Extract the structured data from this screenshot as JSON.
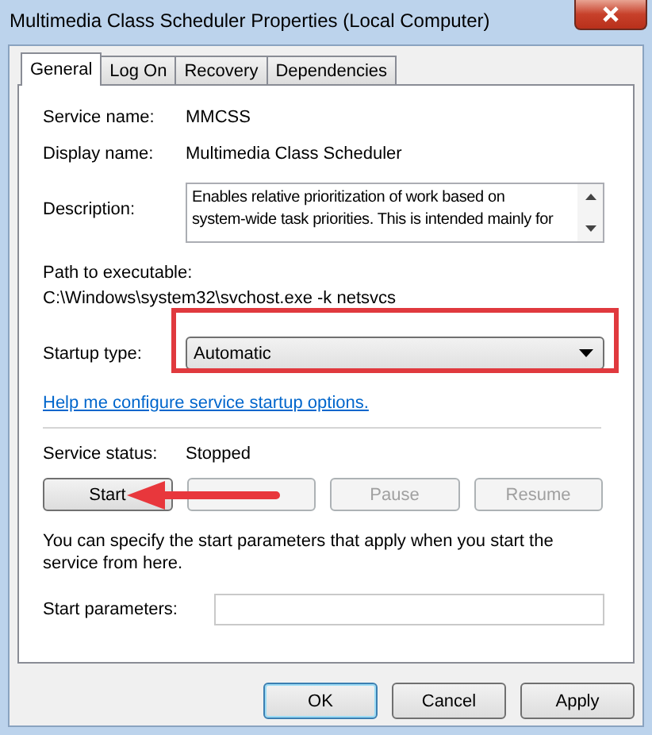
{
  "window": {
    "title": "Multimedia Class Scheduler Properties (Local Computer)"
  },
  "tabs": [
    {
      "label": "General",
      "selected": true
    },
    {
      "label": "Log On",
      "selected": false
    },
    {
      "label": "Recovery",
      "selected": false
    },
    {
      "label": "Dependencies",
      "selected": false
    }
  ],
  "service_name": {
    "label": "Service name:",
    "value": "MMCSS"
  },
  "display_name": {
    "label": "Display name:",
    "value": "Multimedia Class Scheduler"
  },
  "description": {
    "label": "Description:",
    "value": "Enables relative prioritization of work based on\nsystem-wide task priorities. This is intended mainly for"
  },
  "path": {
    "label": "Path to executable:",
    "value": "C:\\Windows\\system32\\svchost.exe -k netsvcs"
  },
  "startup_type": {
    "label": "Startup type:",
    "value": "Automatic"
  },
  "help_link": "Help me configure service startup options.",
  "service_status": {
    "label": "Service status:",
    "value": "Stopped"
  },
  "control_buttons": [
    {
      "label": "Start",
      "disabled": false
    },
    {
      "disabled": true
    },
    {
      "label": "Pause",
      "disabled": true
    },
    {
      "label": "Resume",
      "disabled": true
    }
  ],
  "note": "You can specify the start parameters that apply when you start the service from here.",
  "start_parameters": {
    "label": "Start parameters:"
  },
  "dialog_buttons": [
    {
      "label": "OK",
      "default": true,
      "disabled": false
    },
    {
      "label": "Cancel",
      "default": false,
      "disabled": false
    },
    {
      "label": "Apply",
      "default": false,
      "disabled": false
    }
  ]
}
